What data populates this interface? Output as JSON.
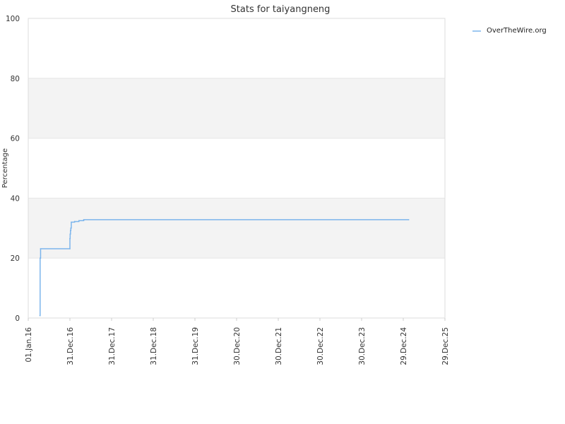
{
  "chart_data": {
    "type": "line",
    "title": "Stats for taiyangneng",
    "xlabel": "",
    "ylabel": "Percentage",
    "ylim": [
      0,
      100
    ],
    "yticks": [
      0,
      20,
      40,
      60,
      80,
      100
    ],
    "xlim": [
      "2016-01-01",
      "2025-12-29"
    ],
    "xticks": [
      {
        "date": "2016-01-01",
        "label": "01.Jan.16"
      },
      {
        "date": "2016-12-31",
        "label": "31.Dec.16"
      },
      {
        "date": "2017-12-31",
        "label": "31.Dec.17"
      },
      {
        "date": "2018-12-31",
        "label": "31.Dec.18"
      },
      {
        "date": "2019-12-31",
        "label": "31.Dec.19"
      },
      {
        "date": "2020-12-30",
        "label": "30.Dec.20"
      },
      {
        "date": "2021-12-30",
        "label": "30.Dec.21"
      },
      {
        "date": "2022-12-30",
        "label": "30.Dec.22"
      },
      {
        "date": "2023-12-30",
        "label": "30.Dec.23"
      },
      {
        "date": "2024-12-29",
        "label": "29.Dec.24"
      },
      {
        "date": "2025-12-29",
        "label": "29.Dec.25"
      }
    ],
    "grid": true,
    "legend_position": "top-right",
    "series": [
      {
        "name": "OverTheWire.org",
        "color": "#7cb5ec",
        "step": true,
        "points": [
          {
            "x": "2016-04-12",
            "y": 0.8
          },
          {
            "x": "2016-04-14",
            "y": 20
          },
          {
            "x": "2016-04-18",
            "y": 23.1
          },
          {
            "x": "2016-12-31",
            "y": 23.1
          },
          {
            "x": "2016-12-31",
            "y": 26.5
          },
          {
            "x": "2017-01-02",
            "y": 28
          },
          {
            "x": "2017-01-05",
            "y": 29.2
          },
          {
            "x": "2017-01-08",
            "y": 30
          },
          {
            "x": "2017-01-12",
            "y": 32
          },
          {
            "x": "2017-02-10",
            "y": 32.2
          },
          {
            "x": "2017-03-20",
            "y": 32.5
          },
          {
            "x": "2017-05-01",
            "y": 32.8
          },
          {
            "x": "2025-02-15",
            "y": 32.8
          }
        ]
      }
    ]
  }
}
